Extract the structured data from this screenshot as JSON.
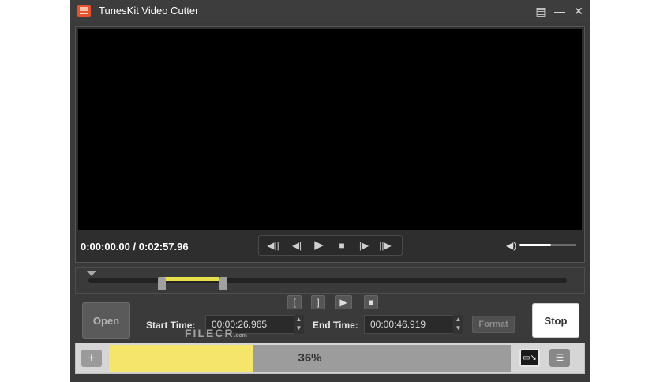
{
  "window": {
    "title": "TunesKit Video Cutter",
    "menu_icon": "menu-icon",
    "minimize_icon": "minimize-icon",
    "close_icon": "close-icon"
  },
  "player": {
    "time_display": "0:00:00.00 / 0:02:57.96",
    "volume_level": 0.55,
    "controls": [
      "previous-frame-icon",
      "step-back-icon",
      "play-icon",
      "stop-icon",
      "step-forward-icon",
      "next-frame-icon"
    ]
  },
  "segment_tools": {
    "set_start_icon": "[",
    "set_end_icon": "]",
    "preview_segment_icon": "preview-segment-icon",
    "stop_preview_icon": "stop-preview-icon"
  },
  "controls": {
    "open_label": "Open",
    "start_time_label": "Start Time:",
    "start_time_value": "00:00:26.965",
    "end_time_label": "End Time:",
    "end_time_value": "00:00:46.919",
    "format_label": "Format",
    "stop_label": "Stop"
  },
  "bottom": {
    "add_label": "+",
    "progress_text": "36%",
    "progress_value": 0.36
  },
  "watermark": {
    "text": "FILECR",
    "suffix": ".com"
  },
  "colors": {
    "app_bg": "#3a3a3a",
    "segment": "#e8e04c",
    "progress_fill": "#f5e56b",
    "logo": "#e8532f"
  }
}
